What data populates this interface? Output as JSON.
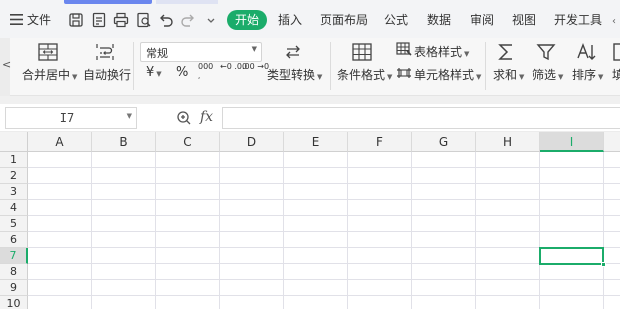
{
  "topbar": {
    "menu_label": "文件",
    "active_tab": "开始",
    "tabs": [
      "插入",
      "页面布局",
      "公式",
      "数据",
      "审阅",
      "视图",
      "开发工具"
    ]
  },
  "ribbon": {
    "left_arrow": "<",
    "merge_label": "合并居中",
    "wrap_label": "自动换行",
    "number_format": "常规",
    "currency_symbol": "¥",
    "percent_symbol": "%",
    "thousands_symbol": "000",
    "inc_decimal": "←0 .00",
    "dec_decimal": ".00 →0",
    "convert_label": "类型转换",
    "cond_format_label": "条件格式",
    "table_style_label": "表格样式",
    "cell_style_label": "单元格样式",
    "sum_label": "求和",
    "filter_label": "筛选",
    "sort_label": "排序",
    "fill_label": "填"
  },
  "formula_bar": {
    "cell_ref": "I7",
    "fx_label": "fx",
    "value": ""
  },
  "sheet": {
    "columns": [
      "A",
      "B",
      "C",
      "D",
      "E",
      "F",
      "G",
      "H",
      "I"
    ],
    "rows": [
      "1",
      "2",
      "3",
      "4",
      "5",
      "6",
      "7",
      "8",
      "9",
      "10"
    ],
    "selected_column": "I",
    "selected_row": "7"
  },
  "colors": {
    "accent_green": "#1bac6a",
    "tab_accent_blue": "#6a86ee"
  }
}
